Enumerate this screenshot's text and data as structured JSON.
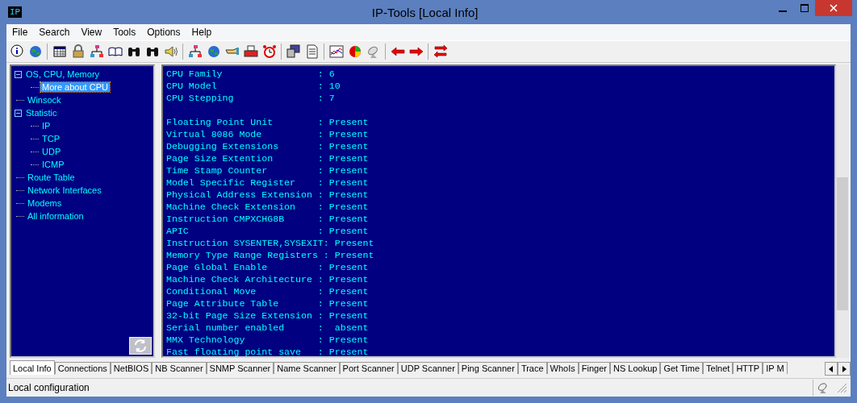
{
  "window": {
    "title": "IP-Tools [Local Info]",
    "app_badge": "IP"
  },
  "menu": [
    "File",
    "Search",
    "View",
    "Tools",
    "Options",
    "Help"
  ],
  "tree": [
    {
      "label": "OS, CPU, Memory",
      "expanded": true,
      "selected": false,
      "children": [
        {
          "label": "More about CPU",
          "selected": true
        }
      ]
    },
    {
      "label": "Winsock",
      "selected": false
    },
    {
      "label": "Statistic",
      "expanded": true,
      "selected": false,
      "children": [
        {
          "label": "IP",
          "selected": false
        },
        {
          "label": "TCP",
          "selected": false
        },
        {
          "label": "UDP",
          "selected": false
        },
        {
          "label": "ICMP",
          "selected": false
        }
      ]
    },
    {
      "label": "Route Table",
      "selected": false
    },
    {
      "label": "Network Interfaces",
      "selected": false
    },
    {
      "label": "Modems",
      "selected": false
    },
    {
      "label": "All information",
      "selected": false
    }
  ],
  "output_blocks": [
    [
      "CPU Family                 : 6",
      "CPU Model                  : 10",
      "CPU Stepping               : 7"
    ],
    [
      "Floating Point Unit        : Present",
      "Virtual 8086 Mode          : Present",
      "Debugging Extensions       : Present",
      "Page Size Extention        : Present",
      "Time Stamp Counter         : Present",
      "Model Specific Register    : Present",
      "Physical Address Extension : Present",
      "Machine Check Extension    : Present",
      "Instruction CMPXCHG8B      : Present",
      "APIC                       : Present",
      "Instruction SYSENTER,SYSEXIT: Present",
      "Memory Type Range Registers : Present",
      "Page Global Enable         : Present",
      "Machine Check Architecture : Present",
      "Conditional Move           : Present",
      "Page Attribute Table       : Present",
      "32-bit Page Size Extension : Present",
      "Serial number enabled      :  absent",
      "MMX Technology             : Present",
      "Fast floating point save   : Present"
    ]
  ],
  "tabs": [
    {
      "label": "Local Info",
      "selected": true
    },
    {
      "label": "Connections",
      "selected": false
    },
    {
      "label": "NetBIOS",
      "selected": false
    },
    {
      "label": "NB Scanner",
      "selected": false
    },
    {
      "label": "SNMP Scanner",
      "selected": false
    },
    {
      "label": "Name Scanner",
      "selected": false
    },
    {
      "label": "Port Scanner",
      "selected": false
    },
    {
      "label": "UDP Scanner",
      "selected": false
    },
    {
      "label": "Ping Scanner",
      "selected": false
    },
    {
      "label": "Trace",
      "selected": false
    },
    {
      "label": "WhoIs",
      "selected": false
    },
    {
      "label": "Finger",
      "selected": false
    },
    {
      "label": "NS Lookup",
      "selected": false
    },
    {
      "label": "Get Time",
      "selected": false
    },
    {
      "label": "Telnet",
      "selected": false
    },
    {
      "label": "HTTP",
      "selected": false
    },
    {
      "label": "IP M",
      "selected": false
    }
  ],
  "status_bar": {
    "text": "Local configuration"
  }
}
